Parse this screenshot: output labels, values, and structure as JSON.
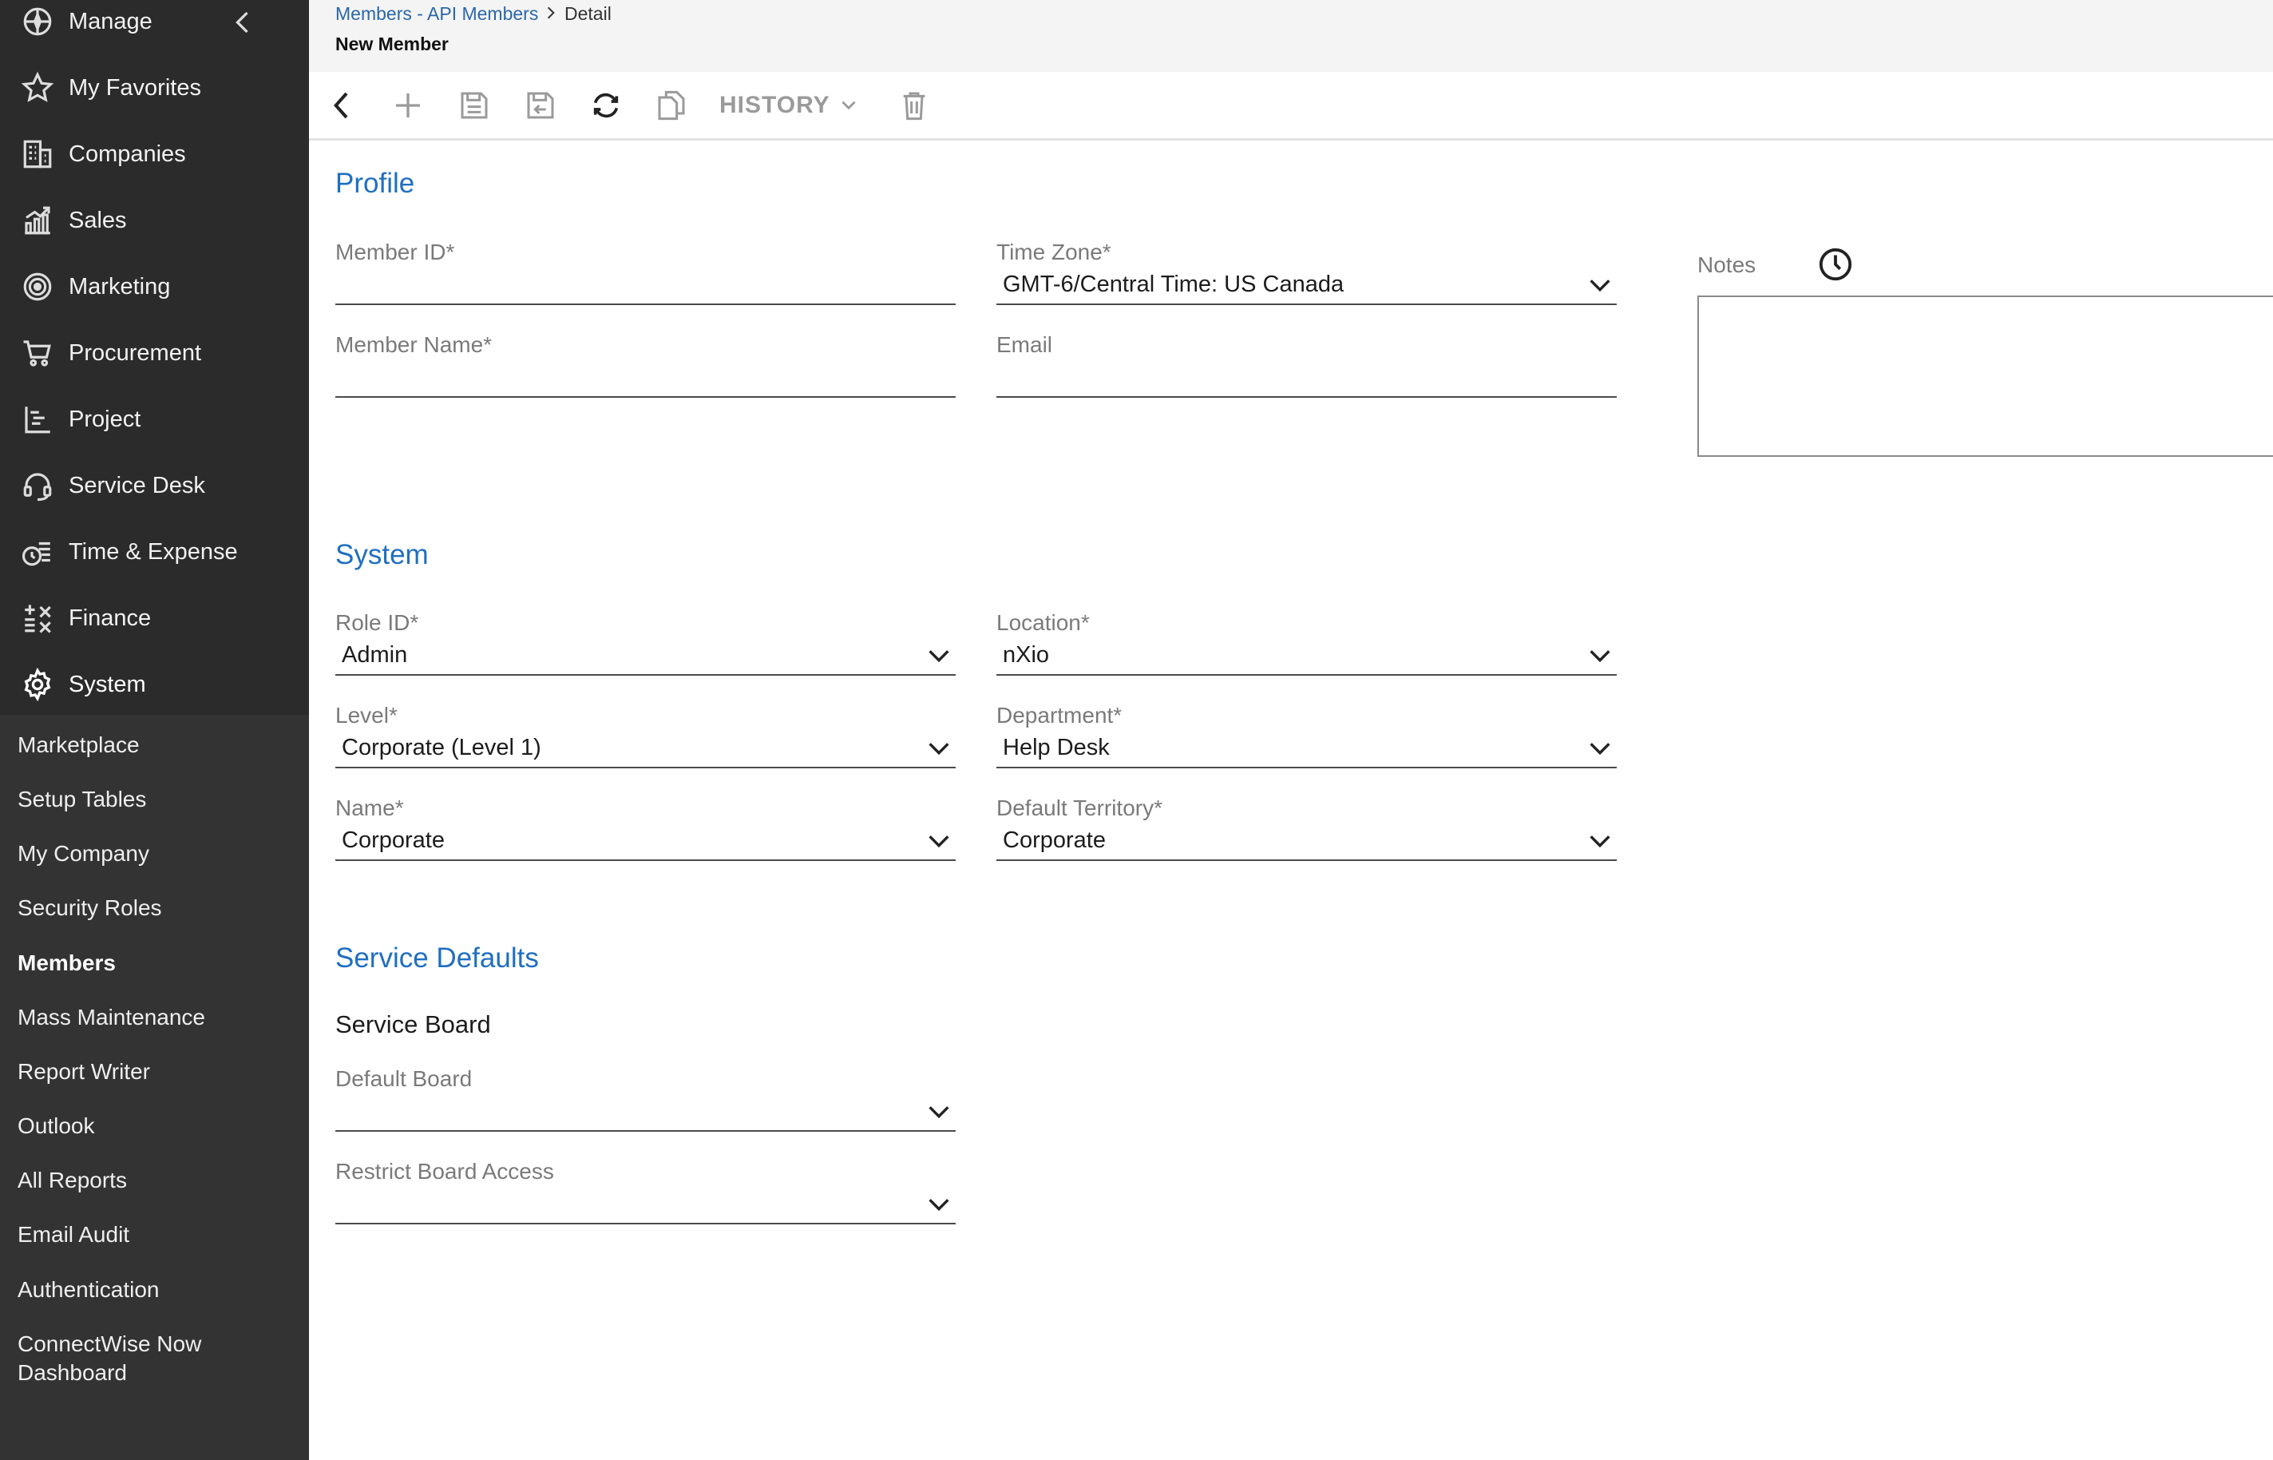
{
  "sidebar": {
    "manage_label": "Manage",
    "items": [
      {
        "label": "My Favorites",
        "icon": "star-icon"
      },
      {
        "label": "Companies",
        "icon": "building-icon"
      },
      {
        "label": "Sales",
        "icon": "chart-icon"
      },
      {
        "label": "Marketing",
        "icon": "target-icon"
      },
      {
        "label": "Procurement",
        "icon": "cart-icon"
      },
      {
        "label": "Project",
        "icon": "gantt-icon"
      },
      {
        "label": "Service Desk",
        "icon": "headset-icon"
      },
      {
        "label": "Time & Expense",
        "icon": "clock-coins-icon"
      },
      {
        "label": "Finance",
        "icon": "math-icon"
      },
      {
        "label": "System",
        "icon": "gear-icon"
      }
    ],
    "sub_items": [
      {
        "label": "Marketplace"
      },
      {
        "label": "Setup Tables"
      },
      {
        "label": "My Company"
      },
      {
        "label": "Security Roles"
      },
      {
        "label": "Members",
        "active": true
      },
      {
        "label": "Mass Maintenance"
      },
      {
        "label": "Report Writer"
      },
      {
        "label": "Outlook"
      },
      {
        "label": "All Reports"
      },
      {
        "label": "Email Audit"
      },
      {
        "label": "Authentication"
      },
      {
        "label": "ConnectWise Now",
        "line2": "Dashboard"
      }
    ]
  },
  "header": {
    "breadcrumb_link": "Members - API Members",
    "breadcrumb_current": "Detail",
    "title": "New Member"
  },
  "toolbar": {
    "history_label": "HISTORY"
  },
  "profile": {
    "title": "Profile",
    "member_id": {
      "label": "Member ID*",
      "value": ""
    },
    "member_name": {
      "label": "Member Name*",
      "value": ""
    },
    "time_zone": {
      "label": "Time Zone*",
      "value": "GMT-6/Central Time: US  Canada"
    },
    "email": {
      "label": "Email",
      "value": ""
    },
    "notes_label": "Notes"
  },
  "system": {
    "title": "System",
    "role_id": {
      "label": "Role ID*",
      "value": "Admin"
    },
    "location": {
      "label": "Location*",
      "value": "nXio"
    },
    "level": {
      "label": "Level*",
      "value": "Corporate (Level 1)"
    },
    "department": {
      "label": "Department*",
      "value": "Help Desk"
    },
    "name": {
      "label": "Name*",
      "value": "Corporate"
    },
    "default_territory": {
      "label": "Default Territory*",
      "value": "Corporate"
    }
  },
  "service_defaults": {
    "title": "Service Defaults",
    "service_board_heading": "Service Board",
    "default_board": {
      "label": "Default Board",
      "value": ""
    },
    "restrict_board_access": {
      "label": "Restrict Board Access",
      "value": ""
    }
  },
  "colors": {
    "sidebar_bg": "#2b2b2b",
    "subnav_bg": "#333333",
    "accent": "#1f6fc0",
    "link": "#2b67a8"
  }
}
